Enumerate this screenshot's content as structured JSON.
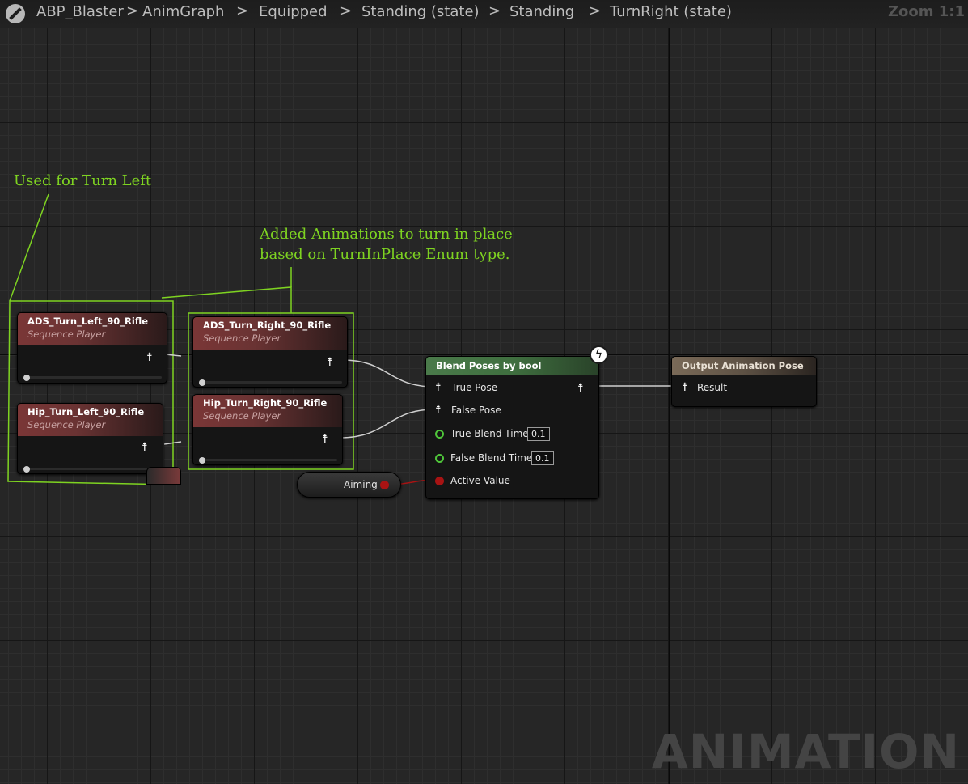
{
  "breadcrumb": {
    "items": [
      "ABP_Blaster",
      "AnimGraph",
      "Equipped",
      "Standing (state)",
      "Standing",
      "TurnRight (state)"
    ],
    "separator": ">",
    "zoom": "Zoom 1:1"
  },
  "comments": {
    "turn_left": "Used for Turn Left",
    "added_line1": "Added Animations to turn in place",
    "added_line2": "based on TurnInPlace Enum type."
  },
  "nodes": {
    "ads_left": {
      "title": "ADS_Turn_Left_90_Rifle",
      "subtitle": "Sequence Player"
    },
    "hip_left": {
      "title": "Hip_Turn_Left_90_Rifle",
      "subtitle": "Sequence Player"
    },
    "ads_right": {
      "title": "ADS_Turn_Right_90_Rifle",
      "subtitle": "Sequence Player"
    },
    "hip_right": {
      "title": "Hip_Turn_Right_90_Rifle",
      "subtitle": "Sequence Player"
    },
    "blend": {
      "title": "Blend Poses by bool",
      "true_pose": "True Pose",
      "false_pose": "False Pose",
      "true_blend_time": "True Blend Time",
      "true_blend_value": "0.1",
      "false_blend_time": "False Blend Time",
      "false_blend_value": "0.1",
      "active_value": "Active Value"
    },
    "output": {
      "title": "Output Animation Pose",
      "result": "Result"
    },
    "aiming": {
      "label": "Aiming"
    }
  },
  "icons": {
    "pose": "pose-pin-icon",
    "bolt": "fast-path-bolt-icon",
    "engine": "unreal-logo-icon"
  },
  "colors": {
    "comment": "#7ed321",
    "sequence_header": "#7a3636",
    "blend_header": "#4a7a4a",
    "output_header": "#7a6a58",
    "bool_pin": "#a81313",
    "float_pin": "#4fc63a"
  },
  "watermark": "ANIMATION"
}
